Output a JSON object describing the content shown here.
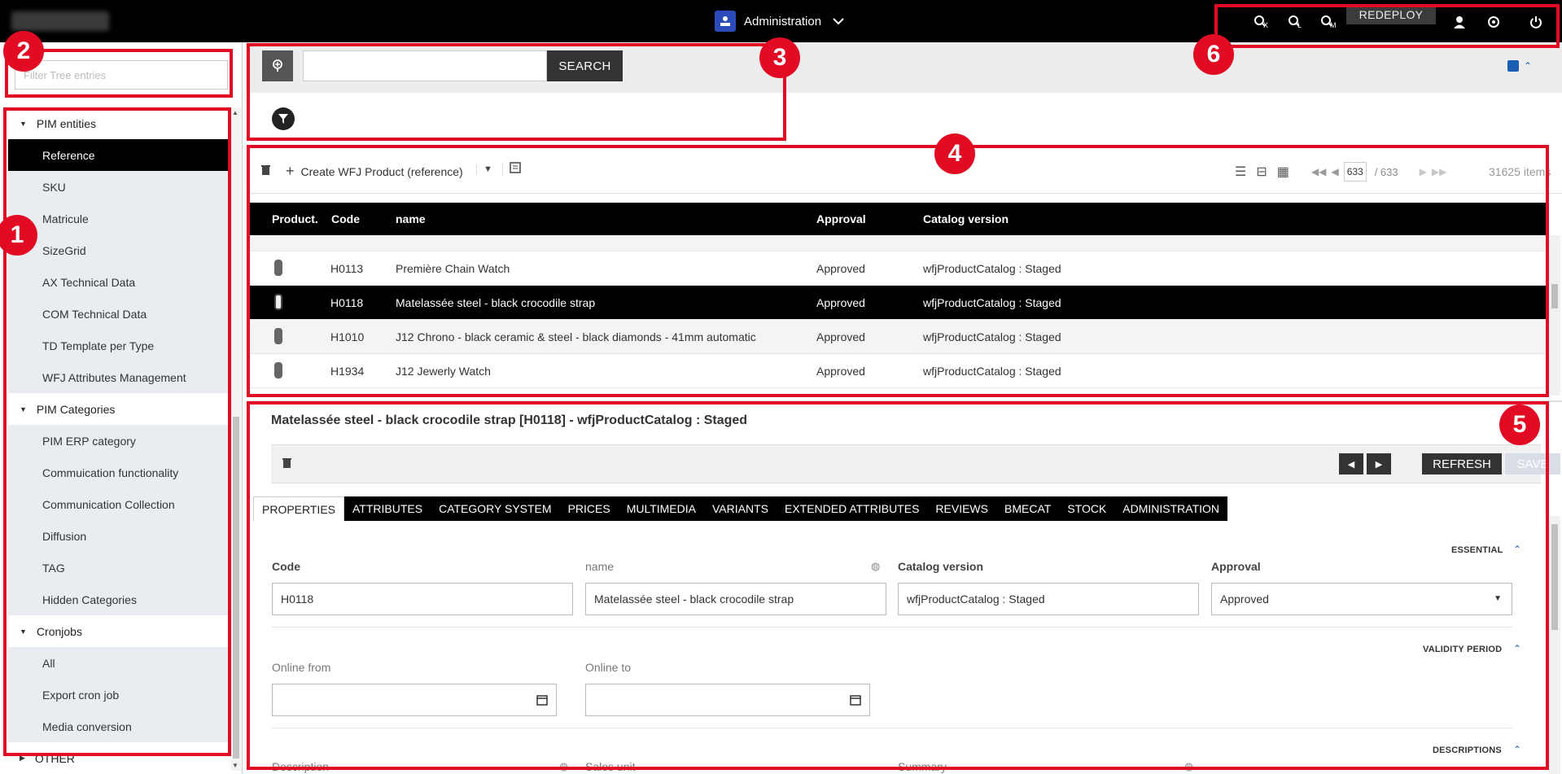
{
  "topbar": {
    "perspective_label": "Administration",
    "redeploy_label": "REDEPLOY",
    "tool_icons": [
      "search-x-icon",
      "search-l-icon",
      "search-m-icon",
      "user-icon",
      "status-icon",
      "power-icon"
    ],
    "tool_letters": [
      "X",
      "L",
      "M"
    ]
  },
  "sidebar": {
    "filter_placeholder": "Filter Tree entries",
    "groups": [
      {
        "label": "PIM entities",
        "expanded": true,
        "items": [
          "Reference",
          "SKU",
          "Matricule",
          "SizeGrid",
          "AX Technical Data",
          "COM Technical Data",
          "TD Template per Type",
          "WFJ Attributes Management"
        ]
      },
      {
        "label": "PIM Categories",
        "expanded": true,
        "items": [
          "PIM ERP category",
          "Commuication functionality",
          "Communication Collection",
          "Diffusion",
          "TAG",
          "Hidden Categories"
        ]
      },
      {
        "label": "Cronjobs",
        "expanded": true,
        "items": [
          "All",
          "Export cron job",
          "Media conversion"
        ]
      },
      {
        "label": "OTHER",
        "expanded": false,
        "items": []
      }
    ],
    "active_item": "Reference"
  },
  "search": {
    "button_label": "SEARCH",
    "query": ""
  },
  "list": {
    "create_label": "Create WFJ Product (reference)",
    "page_current": "633",
    "page_total": "/ 633",
    "items_count": "31625 items",
    "columns": [
      "Product.",
      "Code",
      "name",
      "Approval",
      "Catalog version"
    ],
    "rows": [
      {
        "code": "H0113",
        "name": "Première Chain Watch",
        "approval": "Approved",
        "catalog": "wfjProductCatalog : Staged",
        "selected": false
      },
      {
        "code": "H0118",
        "name": "Matelassée steel - black crocodile strap",
        "approval": "Approved",
        "catalog": "wfjProductCatalog : Staged",
        "selected": true
      },
      {
        "code": "H1010",
        "name": "J12 Chrono - black ceramic & steel - black diamonds - 41mm automatic",
        "approval": "Approved",
        "catalog": "wfjProductCatalog : Staged",
        "selected": false
      },
      {
        "code": "H1934",
        "name": "J12 Jewerly Watch",
        "approval": "Approved",
        "catalog": "wfjProductCatalog : Staged",
        "selected": false
      }
    ]
  },
  "editor": {
    "title": "Matelassée steel - black crocodile strap [H0118] - wfjProductCatalog : Staged",
    "refresh_label": "REFRESH",
    "save_label": "SAVE",
    "tabs": [
      "PROPERTIES",
      "ATTRIBUTES",
      "CATEGORY SYSTEM",
      "PRICES",
      "MULTIMEDIA",
      "VARIANTS",
      "EXTENDED ATTRIBUTES",
      "REVIEWS",
      "BMECAT",
      "STOCK",
      "ADMINISTRATION"
    ],
    "active_tab": "PROPERTIES",
    "sections": {
      "essential": "ESSENTIAL",
      "validity": "VALIDITY PERIOD",
      "descriptions": "DESCRIPTIONS"
    },
    "fields": {
      "code_label": "Code",
      "code_value": "H0118",
      "name_label": "name",
      "name_value": "Matelassée steel - black crocodile strap",
      "catalog_label": "Catalog version",
      "catalog_value": "wfjProductCatalog : Staged",
      "approval_label": "Approval",
      "approval_value": "Approved",
      "online_from_label": "Online from",
      "online_to_label": "Online to",
      "description_label": "Description",
      "sales_unit_label": "Sales unit",
      "summary_label": "Summary"
    }
  },
  "annotations": [
    "1",
    "2",
    "3",
    "4",
    "5",
    "6"
  ],
  "colors": {
    "annotation": "#e10b24",
    "accent": "#1a5fb4",
    "topbar": "#000000"
  }
}
